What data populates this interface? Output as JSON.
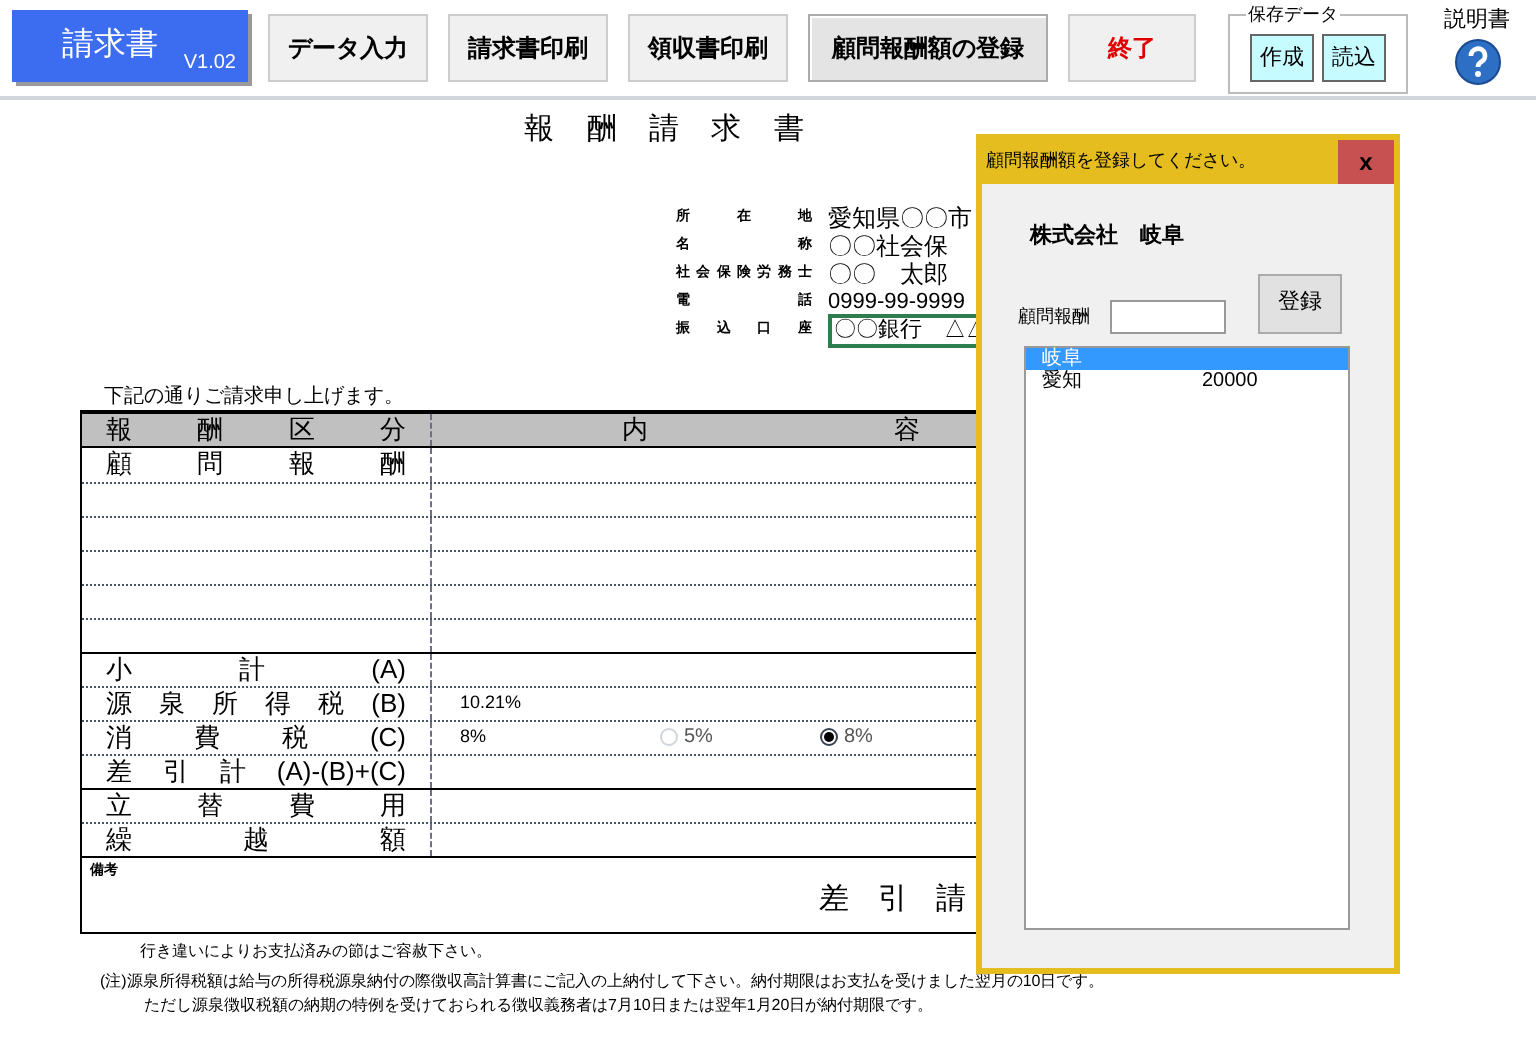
{
  "toolbar": {
    "app_button": {
      "label": "請求書",
      "version": "V1.02"
    },
    "buttons": [
      {
        "label": "データ入力",
        "kind": "normal"
      },
      {
        "label": "請求書印刷",
        "kind": "normal"
      },
      {
        "label": "領収書印刷",
        "kind": "normal"
      },
      {
        "label": "顧問報酬額の登録",
        "kind": "active"
      },
      {
        "label": "終了",
        "kind": "exit"
      }
    ],
    "save_group": {
      "title": "保存データ",
      "buttons": [
        "作成",
        "読込"
      ]
    },
    "help": {
      "label": "説明書"
    }
  },
  "document": {
    "title": "報 酬 請 求 書",
    "issuer": [
      {
        "label": "所 在 地",
        "value": "愛知県〇〇市"
      },
      {
        "label": "名 称",
        "value": "〇〇社会保"
      },
      {
        "label": "社会保険労務士",
        "value": "〇〇　太郎"
      },
      {
        "label": "電 話",
        "value": "0999-99-9999"
      },
      {
        "label": "振 込 口 座",
        "value": "〇〇銀行　△△",
        "kind": "boxed"
      }
    ],
    "intro": "下記の通りご請求申し上げます。",
    "table": {
      "header": {
        "label": "報 酬 区 分",
        "content": [
          "内",
          "容"
        ]
      },
      "rows": [
        {
          "label": "顧 問 報 酬",
          "kind": "item"
        },
        {
          "kind": "blank"
        },
        {
          "kind": "blank"
        },
        {
          "kind": "blank"
        },
        {
          "kind": "blank"
        },
        {
          "kind": "blank"
        },
        {
          "label": "小 計 (A)",
          "kind": "total"
        },
        {
          "label": "源 泉 所 得 税 (B)",
          "value": "10.21%",
          "kind": "item"
        },
        {
          "label": "消 費 税 (C)",
          "value": "8%",
          "kind": "tax",
          "options": [
            {
              "label": "5%",
              "selected": false
            },
            {
              "label": "8%",
              "selected": true
            }
          ]
        },
        {
          "label": "差 引 計 (A)-(B)+(C)",
          "kind": "item"
        },
        {
          "label": "立 替 費 用",
          "kind": "total"
        },
        {
          "label": "繰 越 額",
          "kind": "item"
        }
      ],
      "remarks": {
        "label": "備考",
        "amount_label": "差 引 請"
      }
    },
    "notes": [
      "行き違いによりお支払済みの節はご容赦下さい。",
      "(注)源泉所得税額は給与の所得税源泉納付の際徴収高計算書にご記入の上納付して下さい。納付期限はお支払を受けました翌月の10日です。",
      "ただし源泉徴収税額の納期の特例を受けておられる徴収義務者は7月10日または翌年1月20日が納付期限です。"
    ]
  },
  "dialog": {
    "title": "顧問報酬額を登録してください。",
    "close": "x",
    "company": "株式会社　岐阜",
    "field_label": "顧問報酬",
    "register_button": "登録",
    "list": [
      {
        "name": "岐阜",
        "selected": true
      },
      {
        "name": "愛知",
        "amount": "20000",
        "selected": false
      }
    ]
  }
}
